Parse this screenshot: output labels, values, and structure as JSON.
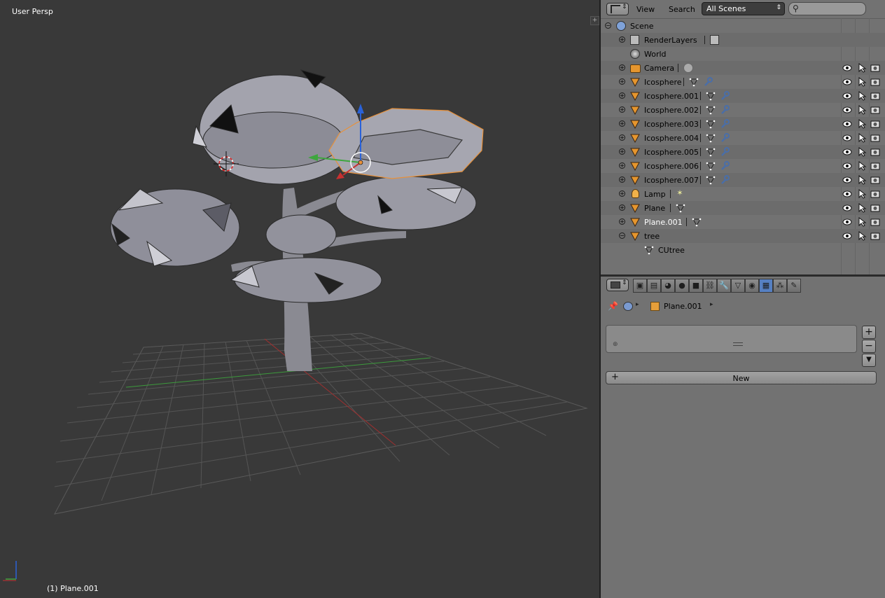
{
  "viewport": {
    "view_label": "User Persp",
    "status": "(1) Plane.001"
  },
  "outliner": {
    "menu_view": "View",
    "menu_search": "Search",
    "scene_select": "All Scenes",
    "rows": [
      {
        "label": "Scene",
        "icon": "scene-icon"
      },
      {
        "label": "RenderLayers",
        "icon": "renderlayers-icon"
      },
      {
        "label": "World",
        "icon": "world-icon"
      },
      {
        "label": "Camera",
        "icon": "camera-icon"
      },
      {
        "label": "Icosphere",
        "icon": "mesh-icon"
      },
      {
        "label": "Icosphere.001",
        "icon": "mesh-icon"
      },
      {
        "label": "Icosphere.002",
        "icon": "mesh-icon"
      },
      {
        "label": "Icosphere.003",
        "icon": "mesh-icon"
      },
      {
        "label": "Icosphere.004",
        "icon": "mesh-icon"
      },
      {
        "label": "Icosphere.005",
        "icon": "mesh-icon"
      },
      {
        "label": "Icosphere.006",
        "icon": "mesh-icon"
      },
      {
        "label": "Icosphere.007",
        "icon": "mesh-icon"
      },
      {
        "label": "Lamp",
        "icon": "lamp-icon"
      },
      {
        "label": "Plane",
        "icon": "mesh-icon"
      },
      {
        "label": "Plane.001",
        "icon": "mesh-icon"
      },
      {
        "label": "tree",
        "icon": "mesh-icon"
      },
      {
        "label": "CUtree",
        "icon": "mesh-data-icon"
      }
    ]
  },
  "properties": {
    "breadcrumb_object": "Plane.001",
    "new_button": "New",
    "active_tab": "texture-tab"
  },
  "colors": {
    "selected_outline": "#e8913a",
    "active_tab": "#5680c2",
    "x_axis": "#b02c2c",
    "y_axis": "#3ea63e",
    "z_axis": "#2a62d8"
  }
}
